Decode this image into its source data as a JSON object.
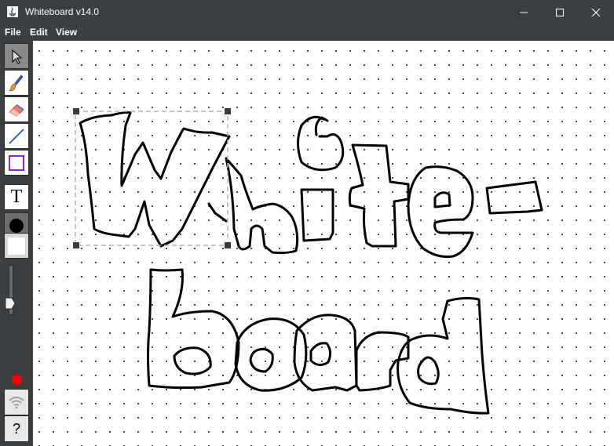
{
  "window": {
    "title": "Whiteboard v14.0"
  },
  "menubar": {
    "items": [
      {
        "label": "File"
      },
      {
        "label": "Edit"
      },
      {
        "label": "View"
      }
    ]
  },
  "toolbar": {
    "tools": [
      {
        "name": "select",
        "icon": "arrow-pointer-icon",
        "active": true
      },
      {
        "name": "brush",
        "icon": "paintbrush-icon"
      },
      {
        "name": "eraser",
        "icon": "eraser-icon"
      },
      {
        "name": "line",
        "icon": "line-icon",
        "color": "#1a4fd6"
      },
      {
        "name": "rectangle",
        "icon": "rectangle-icon",
        "color": "#9b1fd6"
      },
      {
        "name": "text",
        "icon": "text-icon",
        "glyph": "T"
      }
    ],
    "stroke_color": "#000000",
    "fill_color": "#ffffff",
    "stroke_width_level": 0.2,
    "record_color": "#ff0000",
    "help_glyph": "?"
  },
  "canvas": {
    "background": "#ffffff",
    "grid": "dotted",
    "drawing_text": "Whiteboard",
    "selection_visible": true
  }
}
